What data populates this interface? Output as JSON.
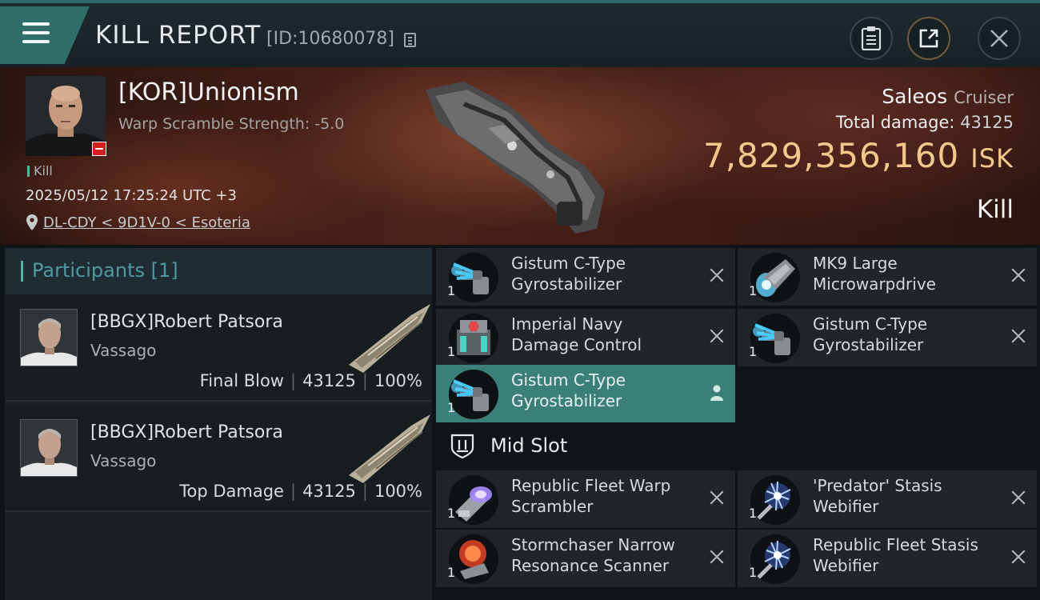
{
  "header": {
    "title": "KILL REPORT",
    "report_id": "[ID:10680078]"
  },
  "victim": {
    "name": "[KOR]Unionism",
    "scramble": "Warp Scramble Strength: -5.0",
    "tag": "Kill",
    "datetime": "2025/05/12 17:25:24 UTC +3",
    "location": "DL-CDY < 9D1V-0 < Esoteria",
    "ship_name": "Saleos",
    "ship_class": "Cruiser",
    "total_damage_label": "Total damage:",
    "total_damage": "43125",
    "isk_value": "7,829,356,160",
    "isk_unit": "ISK",
    "result": "Kill"
  },
  "participants": {
    "label": "Participants",
    "count": "[1]",
    "rows": [
      {
        "name": "[BBGX]Robert Patsora",
        "ship": "Vassago",
        "role": "Final Blow",
        "damage": "43125",
        "percent": "100%"
      },
      {
        "name": "[BBGX]Robert Patsora",
        "ship": "Vassago",
        "role": "Top Damage",
        "damage": "43125",
        "percent": "100%"
      }
    ]
  },
  "fittings": {
    "upper": [
      {
        "qty": "1",
        "line1": "Gistum C-Type",
        "line2": "Gyrostabilizer",
        "icon": "gyrostabilizer-icon",
        "highlighted": false
      },
      {
        "qty": "1",
        "line1": "MK9 Large",
        "line2": "Microwarpdrive",
        "icon": "microwarpdrive-icon",
        "highlighted": false
      },
      {
        "qty": "1",
        "line1": "Imperial Navy",
        "line2": "Damage Control",
        "icon": "damage-control-icon",
        "highlighted": false
      },
      {
        "qty": "1",
        "line1": "Gistum C-Type",
        "line2": "Gyrostabilizer",
        "icon": "gyrostabilizer-icon",
        "highlighted": false
      },
      {
        "qty": "1",
        "line1": "Gistum C-Type",
        "line2": "Gyrostabilizer",
        "icon": "gyrostabilizer-icon",
        "highlighted": true
      }
    ],
    "mid_label": "Mid Slot",
    "mid": [
      {
        "qty": "1",
        "line1": "Republic Fleet Warp",
        "line2": "Scrambler",
        "icon": "warp-scrambler-icon"
      },
      {
        "qty": "1",
        "line1": "'Predator' Stasis",
        "line2": "Webifier",
        "icon": "stasis-webifier-icon"
      },
      {
        "qty": "1",
        "line1": "Stormchaser Narrow",
        "line2": "Resonance Scanner",
        "icon": "resonance-scanner-icon"
      },
      {
        "qty": "1",
        "line1": "Republic Fleet Stasis",
        "line2": "Webifier",
        "icon": "stasis-webifier-icon"
      }
    ]
  },
  "colors": {
    "accent_teal": "#4fb3a6",
    "isk_gold": "#f3c98b",
    "highlight_slot": "#3b7f79",
    "standing_red": "#d21f1f"
  }
}
